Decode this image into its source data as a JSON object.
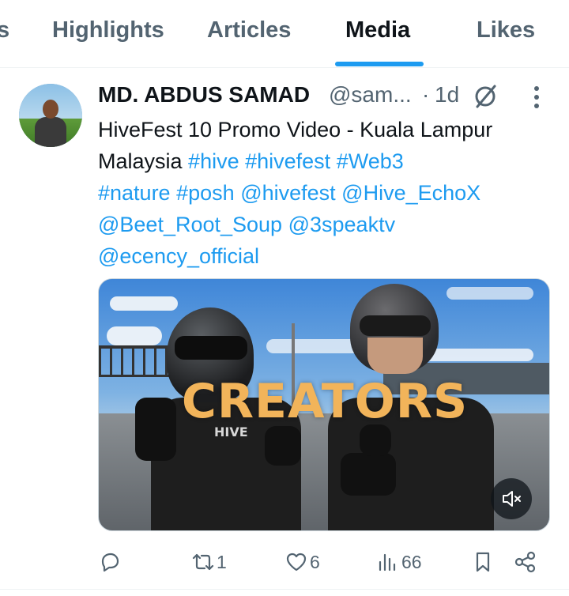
{
  "tabs": [
    {
      "label": "s",
      "active": false
    },
    {
      "label": "Highlights",
      "active": false
    },
    {
      "label": "Articles",
      "active": false
    },
    {
      "label": "Media",
      "active": true
    },
    {
      "label": "Likes",
      "active": false
    }
  ],
  "post": {
    "author_name": "MD. ABDUS SAMAD",
    "handle": "@sam...",
    "separator": "·",
    "time": "1d",
    "text_lines": [
      [
        {
          "t": "HiveFest 10 Promo Video - Kuala Lampur",
          "tag": false
        }
      ],
      [
        {
          "t": "Malaysia ",
          "tag": false
        },
        {
          "t": "#hive",
          "tag": true
        },
        {
          "t": " ",
          "tag": false
        },
        {
          "t": "#hivefest",
          "tag": true
        },
        {
          "t": " ",
          "tag": false
        },
        {
          "t": "#Web3",
          "tag": true
        }
      ],
      [
        {
          "t": "#nature",
          "tag": true
        },
        {
          "t": " ",
          "tag": false
        },
        {
          "t": "#posh",
          "tag": true
        },
        {
          "t": " ",
          "tag": false
        },
        {
          "t": "@hivefest",
          "tag": true
        },
        {
          "t": " ",
          "tag": false
        },
        {
          "t": "@Hive_EchoX",
          "tag": true
        }
      ],
      [
        {
          "t": "@Beet_Root_Soup",
          "tag": true
        },
        {
          "t": " ",
          "tag": false
        },
        {
          "t": "@3speaktv",
          "tag": true
        }
      ],
      [
        {
          "t": "@ecency_official",
          "tag": true
        }
      ]
    ],
    "media": {
      "overlay_text": "CREATORS",
      "jersey_text": "HIVE",
      "mute_icon": "volume-muted-icon"
    },
    "actions": {
      "replies": "",
      "reposts": "1",
      "likes": "6",
      "views": "66"
    }
  },
  "colors": {
    "accent": "#1d9bf0",
    "text": "#0f1419",
    "secondary": "#536471"
  }
}
